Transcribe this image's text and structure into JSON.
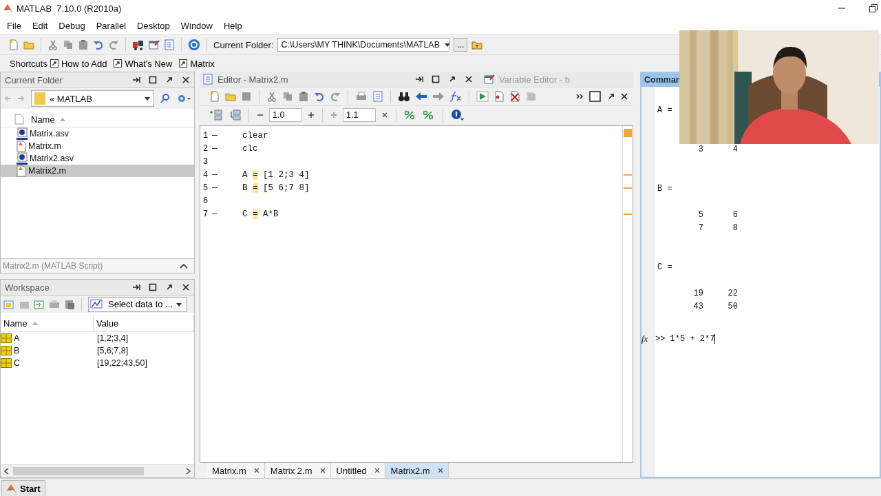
{
  "window": {
    "title": "MATLAB  7.10.0 (R2010a)"
  },
  "menu": [
    "File",
    "Edit",
    "Debug",
    "Parallel",
    "Desktop",
    "Window",
    "Help"
  ],
  "toolbar": {
    "folder_label": "Current Folder:",
    "folder_path": "C:\\Users\\MY THINK\\Documents\\MATLAB",
    "browse": "..."
  },
  "shortcuts": {
    "label": "Shortcuts",
    "items": [
      "How to Add",
      "What's New",
      "Matrix"
    ]
  },
  "current_folder": {
    "title": "Current Folder",
    "path": "« MATLAB",
    "column": {
      "label": "Name",
      "sorted": true
    },
    "files": [
      {
        "name": "Matrix.asv",
        "kind": "asv",
        "selected": false
      },
      {
        "name": "Matrix.m",
        "kind": "script",
        "selected": false
      },
      {
        "name": "Matrix2.asv",
        "kind": "asv",
        "selected": false
      },
      {
        "name": "Matrix2.m",
        "kind": "script",
        "selected": true
      }
    ],
    "details": "Matrix2.m (MATLAB Script)"
  },
  "workspace": {
    "title": "Workspace",
    "select_data": "Select data to ...",
    "columns": [
      {
        "label": "Name",
        "sorted": true
      },
      {
        "label": "Value",
        "sorted": false
      }
    ],
    "variables": [
      {
        "name": "A",
        "value": "[1,2;3,4]"
      },
      {
        "name": "B",
        "value": "[5,6;7,8]"
      },
      {
        "name": "C",
        "value": "[19,22;43,50]"
      }
    ]
  },
  "editor": {
    "title": "Editor - Matrix2.m",
    "variable_editor_tab": "Variable Editor - b",
    "cell_step_1": "1.0",
    "cell_step_2": "1.1",
    "lines": [
      {
        "number": "1",
        "executable": true,
        "warning": false,
        "code": [
          {
            "text": "clear",
            "marked": false
          }
        ]
      },
      {
        "number": "2",
        "executable": true,
        "warning": false,
        "code": [
          {
            "text": "clc",
            "marked": false
          }
        ]
      },
      {
        "number": "3",
        "executable": false,
        "warning": false
      },
      {
        "number": "4",
        "executable": true,
        "warning": true,
        "code": [
          {
            "text": "A ",
            "marked": false
          },
          {
            "text": "=",
            "marked": true
          },
          {
            "text": " [1 2;3 4]",
            "marked": false
          }
        ]
      },
      {
        "number": "5",
        "executable": true,
        "warning": true,
        "code": [
          {
            "text": "B ",
            "marked": false
          },
          {
            "text": "=",
            "marked": true
          },
          {
            "text": " [5 6;7 8]",
            "marked": false
          }
        ]
      },
      {
        "number": "6",
        "executable": false,
        "warning": false
      },
      {
        "number": "7",
        "executable": true,
        "warning": true,
        "code": [
          {
            "text": "C ",
            "marked": false
          },
          {
            "text": "=",
            "marked": true
          },
          {
            "text": " A*B",
            "marked": false
          }
        ]
      }
    ],
    "tabs": [
      {
        "label": "Matrix.m",
        "selected": false
      },
      {
        "label": "Matrix 2.m",
        "selected": false
      },
      {
        "label": "Untitled",
        "selected": false
      },
      {
        "label": "Matrix2.m",
        "selected": true
      }
    ]
  },
  "command_window": {
    "title": "Comman",
    "output": [
      {
        "label": "A =",
        "rows": [
          [
            "3",
            "4"
          ]
        ]
      },
      {
        "label": "B =",
        "rows": [
          [
            "5",
            "6"
          ],
          [
            "7",
            "8"
          ]
        ]
      },
      {
        "label": "C =",
        "rows": [
          [
            "19",
            "22"
          ],
          [
            "43",
            "50"
          ]
        ]
      }
    ],
    "prompt_icon": "fx",
    "input": ">> 1*5 + 2*7"
  },
  "taskbar": {
    "start": "Start"
  }
}
